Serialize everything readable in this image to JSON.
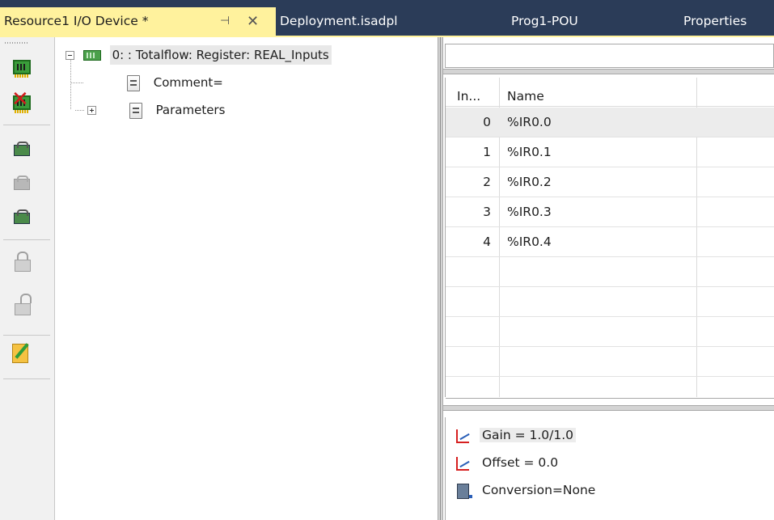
{
  "tabs": [
    {
      "label": "Resource1 I/O Device *",
      "active": true,
      "pin_icon": "pin-icon",
      "close_icon": "close-icon"
    },
    {
      "label": "Deployment.isadpl"
    },
    {
      "label": "Prog1-POU"
    },
    {
      "label": "Properties"
    }
  ],
  "toolbar": {
    "buttons": [
      {
        "name": "add-board-icon"
      },
      {
        "name": "delete-board-icon"
      },
      {
        "name": "connect-device-icon"
      },
      {
        "name": "disconnect-device-icon"
      },
      {
        "name": "device-settings-icon"
      },
      {
        "name": "lock-icon"
      },
      {
        "name": "unlock-icon"
      },
      {
        "name": "edit-note-icon"
      }
    ]
  },
  "tree": {
    "root_label": "0: : Totalflow: Register: REAL_Inputs",
    "children": [
      {
        "label": "Comment="
      },
      {
        "label": "Parameters"
      }
    ]
  },
  "grid": {
    "headers": {
      "index": "In...",
      "name": "Name"
    },
    "rows": [
      {
        "index": "0",
        "name": "%IR0.0"
      },
      {
        "index": "1",
        "name": "%IR0.1"
      },
      {
        "index": "2",
        "name": "%IR0.2"
      },
      {
        "index": "3",
        "name": "%IR0.3"
      },
      {
        "index": "4",
        "name": "%IR0.4"
      }
    ]
  },
  "properties": [
    {
      "label": "Gain = 1.0/1.0"
    },
    {
      "label": "Offset = 0.0"
    },
    {
      "label": "Conversion=None"
    }
  ]
}
